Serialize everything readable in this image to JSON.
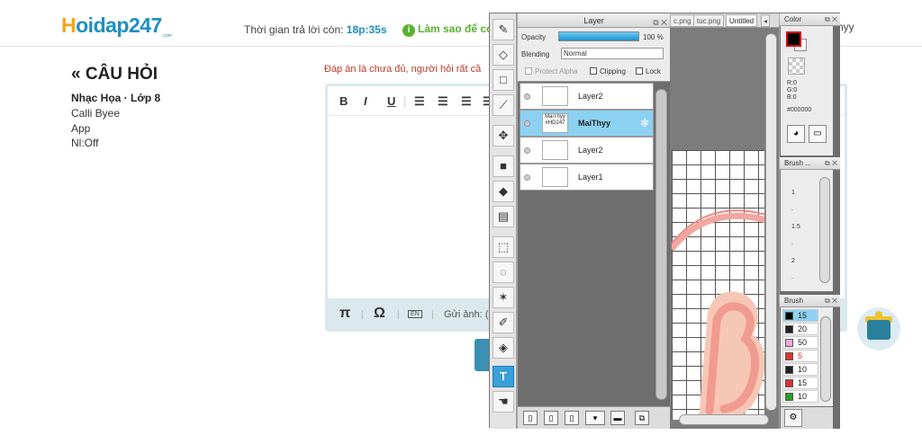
{
  "header": {
    "logo_h": "H",
    "logo_rest": "oidap247",
    "logo_sub": ".com",
    "timer_label": "Thời gian trả lời còn: ",
    "timer_value": "18p:35s",
    "help_text": "Làm sao để có",
    "help_icon": "info-icon",
    "username": "hyy"
  },
  "question": {
    "title": "« CÂU HỎI",
    "subject": "Nhạc Họa · Lớp 8",
    "lines": [
      "Calli Byee",
      "App",
      "Nl:Off"
    ]
  },
  "answer": {
    "warning": "Đáp án là chưa đủ, người hỏi rất cầ",
    "toolbar": [
      "B",
      "I",
      "U"
    ],
    "bottom_tools": {
      "pi": "π",
      "omega": "Ω",
      "en": "EN",
      "upload": "Gửi ảnh: ("
    }
  },
  "paint_app": {
    "layer_panel": {
      "title": "Layer",
      "opacity_label": "Opacity",
      "opacity_value": "100 %",
      "blending_label": "Blending",
      "blending_value": "Normal",
      "protect_alpha": "Protect Alpha",
      "clipping": "Clipping",
      "lock": "Lock",
      "layers": [
        {
          "name": "Layer2",
          "thumb": "",
          "selected": false
        },
        {
          "name": "MaiThyy",
          "thumb": "MaiThyy #HD247",
          "selected": true
        },
        {
          "name": "Layer2",
          "thumb": "",
          "selected": false
        },
        {
          "name": "Layer1",
          "thumb": "",
          "selected": false
        }
      ]
    },
    "tabs": [
      "c.png",
      "tuc.png",
      "Untitled"
    ],
    "color_panel": {
      "title": "Color",
      "r": "R:0",
      "g": "G:0",
      "b": "B:0",
      "hex": "#000000",
      "fg_color": "#000000"
    },
    "brush_size_panel": {
      "title": "Brush ...",
      "values": [
        "1",
        ".",
        "1.5",
        ".",
        "2",
        "."
      ]
    },
    "brush_panel": {
      "title": "Brush",
      "brushes": [
        {
          "size": "15",
          "color": "#000000",
          "selected": true
        },
        {
          "size": "20",
          "color": "#222222",
          "selected": false
        },
        {
          "size": "50",
          "color": "#f4a6e0",
          "selected": false
        },
        {
          "size": "5",
          "color": "#e23030",
          "selected": false
        },
        {
          "size": "10",
          "color": "#222222",
          "selected": false
        },
        {
          "size": "15",
          "color": "#e23030",
          "selected": false
        },
        {
          "size": "10",
          "color": "#22a022",
          "selected": false
        }
      ]
    }
  }
}
